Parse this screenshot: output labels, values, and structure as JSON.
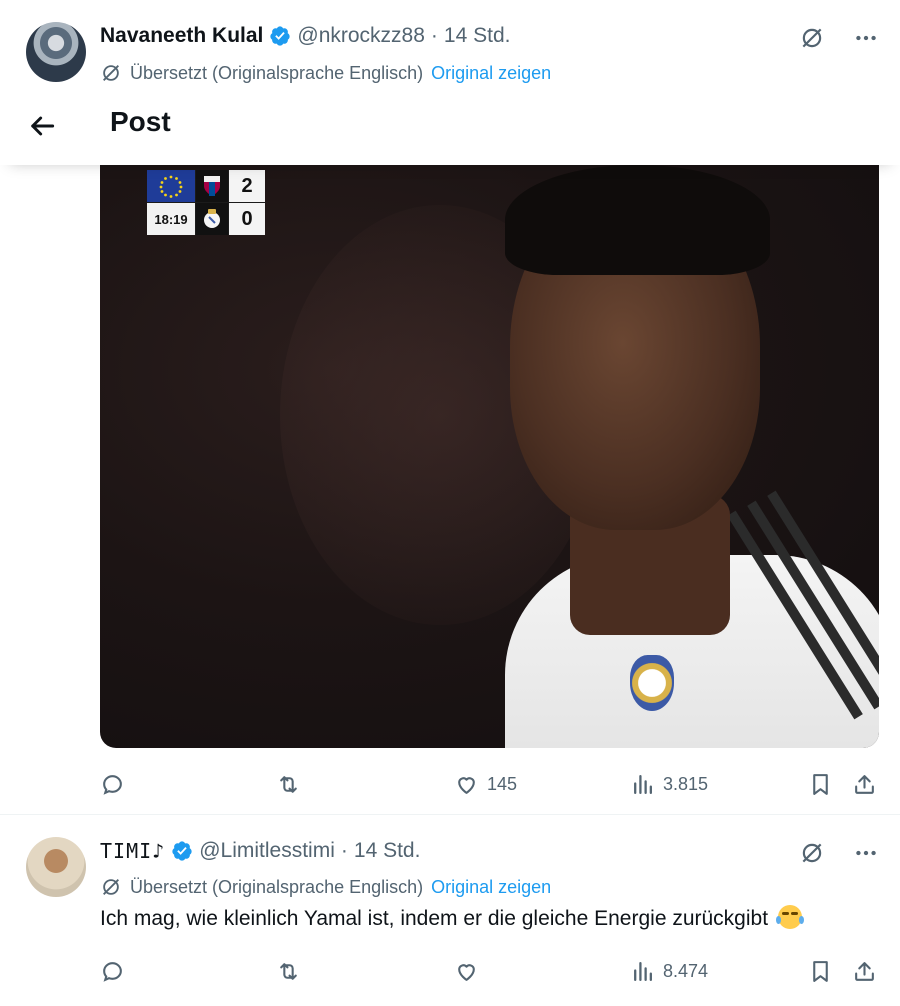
{
  "post_header": {
    "title": "Post"
  },
  "tweets": [
    {
      "author_name": "Navaneeth Kulal",
      "handle": "@nkrockzz88",
      "separator": "·",
      "time": "14 Std.",
      "translated_label": "Übersetzt (Originalsprache Englisch)",
      "show_original": "Original zeigen",
      "media": {
        "scoreboard": {
          "clock": "18:19",
          "home_score": "2",
          "away_score": "0"
        }
      },
      "stats": {
        "replies": "",
        "reposts": "",
        "likes": "145",
        "views": "3.815"
      }
    },
    {
      "author_name": "TIMI♪",
      "handle": "@Limitlesstimi",
      "separator": "·",
      "time": "14 Std.",
      "translated_label": "Übersetzt (Originalsprache Englisch)",
      "show_original": "Original zeigen",
      "text": "Ich mag, wie kleinlich Yamal ist, indem er die gleiche Energie zurückgibt",
      "emoji": "face-with-tears-of-joy",
      "stats": {
        "replies": "",
        "reposts": "",
        "likes": "",
        "views": "8.474"
      }
    }
  ],
  "icons": {
    "verified": "verified-badge-icon",
    "translate": "translate-icon",
    "grok": "grok-icon",
    "more": "more-icon",
    "back": "back-arrow-icon",
    "reply": "reply-icon",
    "repost": "repost-icon",
    "like": "like-icon",
    "views": "views-icon",
    "bookmark": "bookmark-icon",
    "share": "share-icon"
  },
  "colors": {
    "accent": "#1d9bf0",
    "secondary_text": "#536471",
    "primary_text": "#0f1419"
  }
}
